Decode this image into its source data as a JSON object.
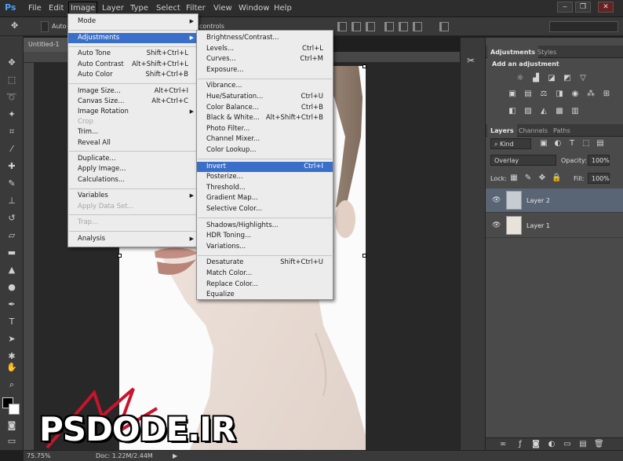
{
  "app": {
    "logo": "Ps",
    "menu": [
      "File",
      "Edit",
      "Image",
      "Layer",
      "Type",
      "Select",
      "Filter",
      "View",
      "Window",
      "Help"
    ],
    "active_menu": "Image",
    "window_buttons": [
      "minimize",
      "restore",
      "close"
    ]
  },
  "options_bar": {
    "auto_select_label": "Auto-",
    "controls_label": "controls"
  },
  "document": {
    "tab_title": "Untitled-1",
    "zoom": "75.75%",
    "doc_info": "Doc: 1.22M/2.44M"
  },
  "image_menu": [
    {
      "label": "Mode",
      "submenu": true
    },
    {
      "separator": true
    },
    {
      "label": "Adjustments",
      "submenu": true,
      "highlighted": true
    },
    {
      "separator": true
    },
    {
      "label": "Auto Tone",
      "shortcut": "Shift+Ctrl+L"
    },
    {
      "label": "Auto Contrast",
      "shortcut": "Alt+Shift+Ctrl+L"
    },
    {
      "label": "Auto Color",
      "shortcut": "Shift+Ctrl+B"
    },
    {
      "separator": true
    },
    {
      "label": "Image Size...",
      "shortcut": "Alt+Ctrl+I"
    },
    {
      "label": "Canvas Size...",
      "shortcut": "Alt+Ctrl+C"
    },
    {
      "label": "Image Rotation",
      "submenu": true
    },
    {
      "label": "Crop",
      "disabled": true
    },
    {
      "label": "Trim..."
    },
    {
      "label": "Reveal All"
    },
    {
      "separator": true
    },
    {
      "label": "Duplicate..."
    },
    {
      "label": "Apply Image..."
    },
    {
      "label": "Calculations..."
    },
    {
      "separator": true
    },
    {
      "label": "Variables",
      "submenu": true
    },
    {
      "label": "Apply Data Set...",
      "disabled": true
    },
    {
      "separator": true
    },
    {
      "label": "Trap...",
      "disabled": true
    },
    {
      "separator": true
    },
    {
      "label": "Analysis",
      "submenu": true
    }
  ],
  "adjustments_menu": [
    {
      "label": "Brightness/Contrast..."
    },
    {
      "label": "Levels...",
      "shortcut": "Ctrl+L"
    },
    {
      "label": "Curves...",
      "shortcut": "Ctrl+M"
    },
    {
      "label": "Exposure..."
    },
    {
      "separator": true
    },
    {
      "label": "Vibrance..."
    },
    {
      "label": "Hue/Saturation...",
      "shortcut": "Ctrl+U"
    },
    {
      "label": "Color Balance...",
      "shortcut": "Ctrl+B"
    },
    {
      "label": "Black & White...",
      "shortcut": "Alt+Shift+Ctrl+B"
    },
    {
      "label": "Photo Filter..."
    },
    {
      "label": "Channel Mixer..."
    },
    {
      "label": "Color Lookup..."
    },
    {
      "separator": true
    },
    {
      "label": "Invert",
      "shortcut": "Ctrl+I",
      "highlighted": true
    },
    {
      "label": "Posterize..."
    },
    {
      "label": "Threshold..."
    },
    {
      "label": "Gradient Map..."
    },
    {
      "label": "Selective Color..."
    },
    {
      "separator": true
    },
    {
      "label": "Shadows/Highlights..."
    },
    {
      "label": "HDR Toning..."
    },
    {
      "label": "Variations..."
    },
    {
      "separator": true
    },
    {
      "label": "Desaturate",
      "shortcut": "Shift+Ctrl+U"
    },
    {
      "label": "Match Color..."
    },
    {
      "label": "Replace Color..."
    },
    {
      "label": "Equalize"
    }
  ],
  "adjustments_panel": {
    "tabs": [
      "Adjustments",
      "Styles"
    ],
    "heading": "Add an adjustment",
    "icons_row1": [
      "brightness-icon",
      "levels-icon",
      "curves-icon",
      "exposure-icon",
      "triangle-icon"
    ],
    "icons_row2": [
      "vibrance-icon",
      "hue-sat-icon",
      "color-balance-icon",
      "bw-icon",
      "photo-filter-icon",
      "channel-mixer-icon",
      "color-lookup-icon"
    ],
    "icons_row3": [
      "invert-icon",
      "posterize-icon",
      "threshold-icon",
      "selective-color-icon",
      "gradient-map-icon"
    ]
  },
  "layers_panel": {
    "tabs": [
      "Layers",
      "Channels",
      "Paths"
    ],
    "kind_label": "Kind",
    "blend_mode": "Overlay",
    "opacity_label": "Opacity:",
    "opacity_value": "100%",
    "lock_label": "Lock:",
    "fill_label": "Fill:",
    "fill_value": "100%",
    "layers": [
      {
        "name": "Layer 2",
        "selected": true
      },
      {
        "name": "Layer 1",
        "selected": false
      }
    ]
  },
  "watermark": {
    "text": "PSDODE.IR"
  },
  "colors": {
    "menu_highlight": "#3a6fc9",
    "layer_selected": "#596474",
    "ps_blue": "#4aa0ff"
  }
}
